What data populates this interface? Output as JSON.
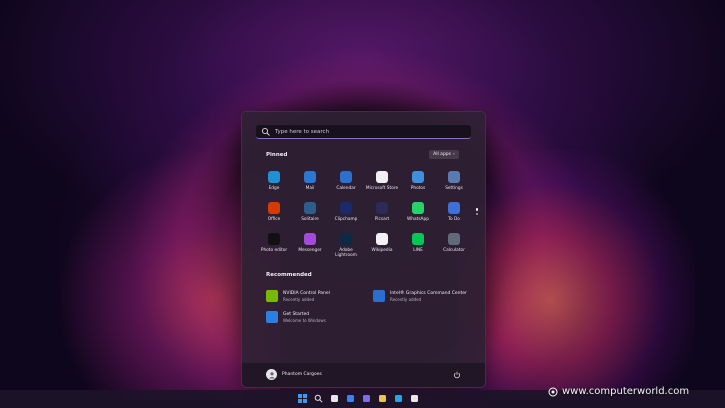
{
  "search": {
    "placeholder": "Type here to search"
  },
  "pinned": {
    "title": "Pinned",
    "all_apps_label": "All apps",
    "apps": [
      {
        "label": "Edge",
        "icon": "edge-icon",
        "color": "#1f8fd6"
      },
      {
        "label": "Mail",
        "icon": "mail-icon",
        "color": "#2a78d4"
      },
      {
        "label": "Calendar",
        "icon": "calendar-icon",
        "color": "#2b6fd1"
      },
      {
        "label": "Microsoft Store",
        "icon": "store-icon",
        "color": "#f0f0f0"
      },
      {
        "label": "Photos",
        "icon": "photos-icon",
        "color": "#3d8fe0"
      },
      {
        "label": "Settings",
        "icon": "settings-icon",
        "color": "#5b7ab0"
      },
      {
        "label": "Office",
        "icon": "office-icon",
        "color": "#d83b01"
      },
      {
        "label": "Solitaire",
        "icon": "solitaire-icon",
        "color": "#2d5d8c"
      },
      {
        "label": "Clipchamp",
        "icon": "clipchamp-icon",
        "color": "#1a2a6a"
      },
      {
        "label": "Picsart",
        "icon": "picsart-icon",
        "color": "#2b2b5a"
      },
      {
        "label": "WhatsApp",
        "icon": "whatsapp-icon",
        "color": "#25d366"
      },
      {
        "label": "To Do",
        "icon": "todo-icon",
        "color": "#3f6fd8"
      },
      {
        "label": "Photo editor",
        "icon": "photo-editor-icon",
        "color": "#111111"
      },
      {
        "label": "Messenger",
        "icon": "messenger-icon",
        "color": "#a24bd8"
      },
      {
        "label": "Adobe Lightroom",
        "icon": "lightroom-icon",
        "color": "#0c2a44"
      },
      {
        "label": "Wikipedia",
        "icon": "wikipedia-icon",
        "color": "#f2f2f2"
      },
      {
        "label": "LINE",
        "icon": "line-icon",
        "color": "#06c755"
      },
      {
        "label": "Calculator",
        "icon": "calculator-icon",
        "color": "#5f6b7a"
      }
    ]
  },
  "recommended": {
    "title": "Recommended",
    "items": [
      {
        "name": "NVIDIA Control Panel",
        "sub": "Recently added",
        "icon": "nvidia-icon",
        "color": "#76b900"
      },
      {
        "name": "Intel® Graphics Command Center",
        "sub": "Recently added",
        "icon": "intel-graphics-icon",
        "color": "#2a6fd0"
      },
      {
        "name": "Get Started",
        "sub": "Welcome to Windows",
        "icon": "get-started-icon",
        "color": "#2a7fe0"
      }
    ]
  },
  "user": {
    "name": "Phantom Cargoes"
  },
  "taskbar": {
    "icons": [
      "windows-icon",
      "search-icon",
      "task-view-icon",
      "widgets-icon",
      "chat-icon",
      "file-explorer-icon",
      "edge-icon",
      "store-icon"
    ]
  },
  "watermark": {
    "text": "www.computerworld.com"
  }
}
